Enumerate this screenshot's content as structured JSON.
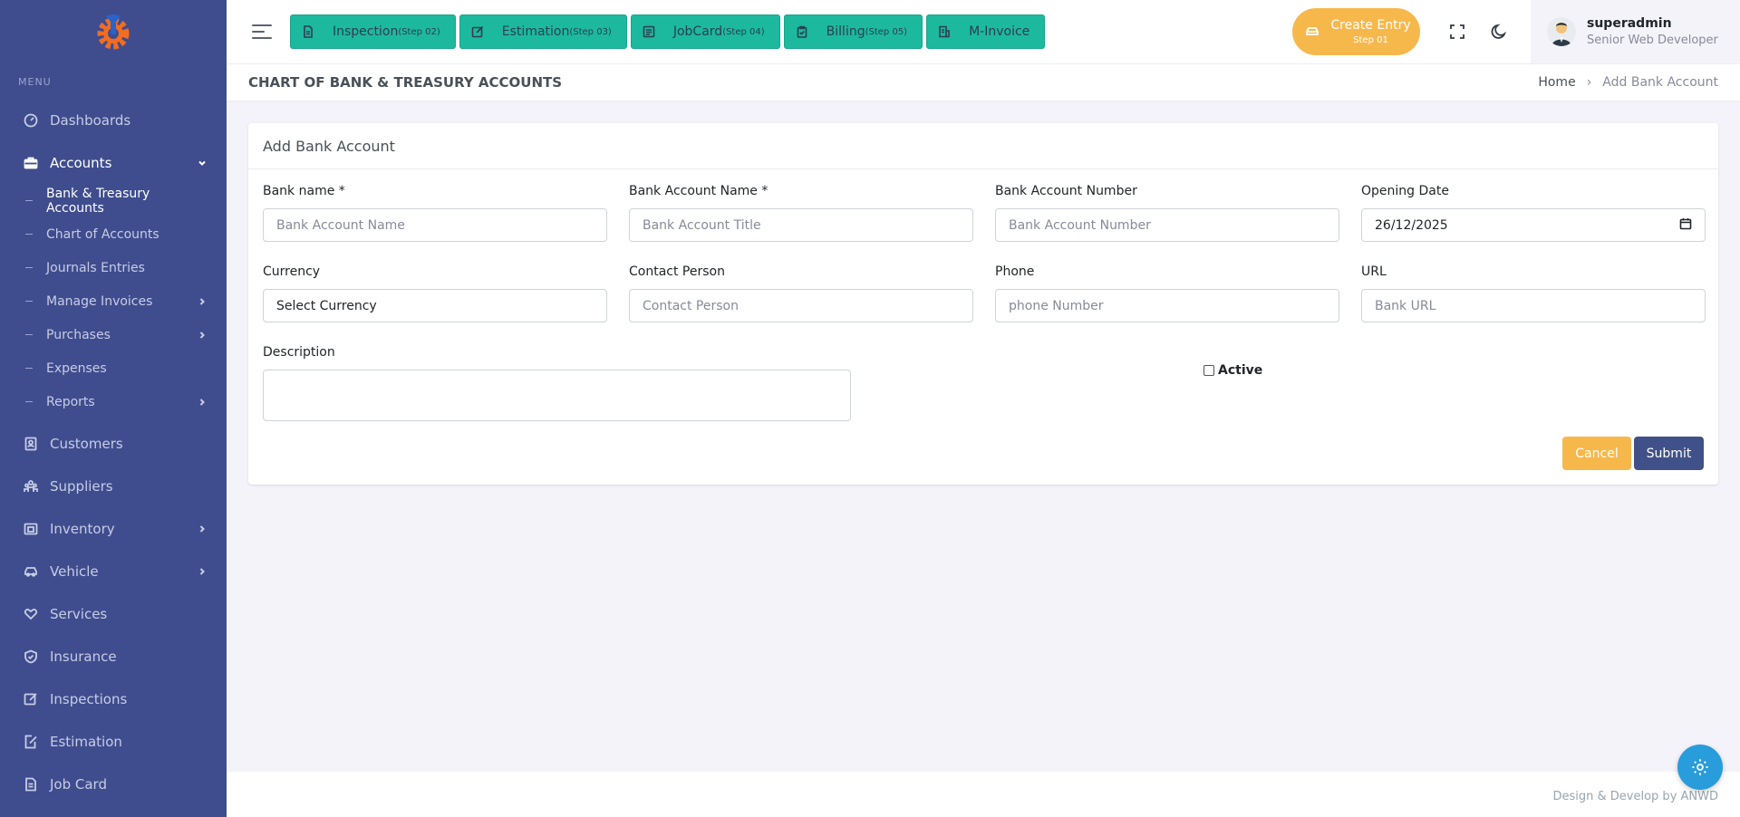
{
  "sidebar": {
    "menu_title": "MENU",
    "items": [
      {
        "label": "Dashboards",
        "icon": "dashboard-icon"
      },
      {
        "label": "Accounts",
        "icon": "briefcase-icon"
      },
      {
        "label": "Customers",
        "icon": "user-file-icon"
      },
      {
        "label": "Suppliers",
        "icon": "team-icon"
      },
      {
        "label": "Inventory",
        "icon": "store-icon"
      },
      {
        "label": "Vehicle",
        "icon": "car-icon"
      },
      {
        "label": "Services",
        "icon": "heart-hand-icon"
      },
      {
        "label": "Insurance",
        "icon": "shield-icon"
      },
      {
        "label": "Inspections",
        "icon": "edit-box-icon"
      },
      {
        "label": "Estimation",
        "icon": "edit-file-icon"
      },
      {
        "label": "Job Card",
        "icon": "file-icon"
      }
    ],
    "accounts_sub": [
      {
        "label": "Bank & Treasury Accounts"
      },
      {
        "label": "Chart of Accounts"
      },
      {
        "label": "Journals Entries"
      },
      {
        "label": "Manage Invoices"
      },
      {
        "label": "Purchases"
      },
      {
        "label": "Expenses"
      },
      {
        "label": "Reports"
      }
    ]
  },
  "topbar": {
    "steps": [
      {
        "label": "Inspection",
        "step": "(Step 02)"
      },
      {
        "label": "Estimation",
        "step": "(Step 03)"
      },
      {
        "label": "JobCard",
        "step": "(Step 04)"
      },
      {
        "label": "Billing",
        "step": "(Step 05)"
      },
      {
        "label": "M-Invoice",
        "step": ""
      }
    ],
    "create_entry": {
      "label": "Create Entry",
      "step": "Step 01"
    },
    "user": {
      "name": "superadmin",
      "role": "Senior Web Developer"
    }
  },
  "page": {
    "title": "CHART OF BANK & TREASURY ACCOUNTS",
    "breadcrumb": {
      "home": "Home",
      "current": "Add Bank Account"
    }
  },
  "form": {
    "card_title": "Add Bank Account",
    "bank_name": {
      "label": "Bank name *",
      "placeholder": "Bank Account Name"
    },
    "bank_account_name": {
      "label": "Bank Account Name *",
      "placeholder": "Bank Account Title"
    },
    "bank_account_number": {
      "label": "Bank Account Number",
      "placeholder": "Bank Account Number"
    },
    "opening_date": {
      "label": "Opening Date",
      "value": "26/12/2025"
    },
    "currency": {
      "label": "Currency",
      "value": "Select Currency"
    },
    "contact_person": {
      "label": "Contact Person",
      "placeholder": "Contact Person"
    },
    "phone": {
      "label": "Phone",
      "placeholder": "phone Number"
    },
    "url": {
      "label": "URL",
      "placeholder": "Bank URL"
    },
    "description": {
      "label": "Description"
    },
    "active": {
      "label": "Active"
    },
    "cancel_label": "Cancel",
    "submit_label": "Submit"
  },
  "footer": {
    "text": "Design & Develop by ANWD"
  },
  "colors": {
    "sidebar_bg": "#3f4d8e",
    "step_button": "#1cb99e",
    "create_entry": "#f7b84b",
    "submit": "#405189",
    "fab": "#299cdb"
  }
}
